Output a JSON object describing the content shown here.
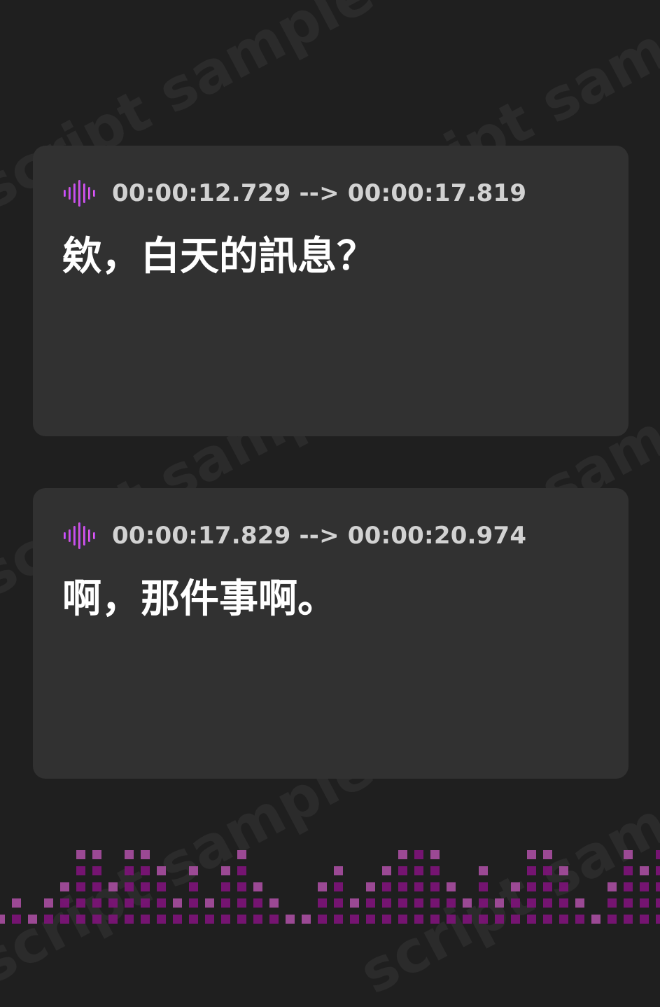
{
  "watermark": {
    "text": "script sample"
  },
  "subtitles": [
    {
      "timecode": "00:00:12.729 --> 00:00:17.819",
      "text": "欸，白天的訊息？"
    },
    {
      "timecode": "00:00:17.829 --> 00:00:20.974",
      "text": "啊，那件事啊。"
    }
  ],
  "icons": {
    "cue": "audio-wave-icon",
    "footer": "equalizer-icon"
  },
  "colors": {
    "background": "#1f1f1f",
    "card": "#313131",
    "text": "#ffffff",
    "timecode": "#d2d2d2",
    "accent_start": "#ff6ad5",
    "accent_end": "#8a35ff",
    "equalizer": "#7e137a",
    "equalizer_peak": "#a24c9b"
  }
}
